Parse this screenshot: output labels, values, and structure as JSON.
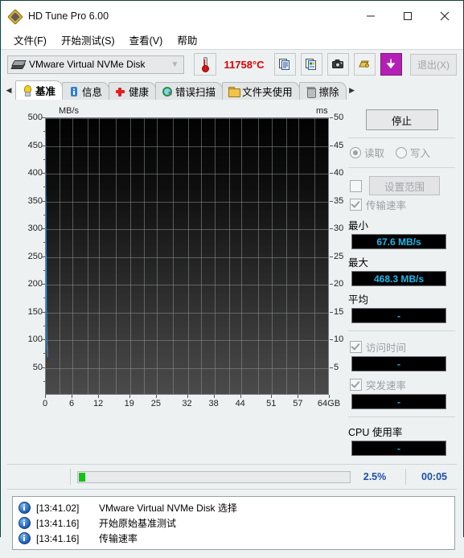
{
  "window": {
    "title": "HD Tune Pro 6.00",
    "app_icon": "hdtune-diamond-icon",
    "minimize": "minimize-icon",
    "maximize": "maximize-icon",
    "close": "close-icon"
  },
  "menu": [
    {
      "label": "文件(F)"
    },
    {
      "label": "开始测试(S)"
    },
    {
      "label": "查看(V)"
    },
    {
      "label": "帮助"
    }
  ],
  "toolbar": {
    "disk": "VMware Virtual NVMe Disk",
    "disk_icon": "hard-disk-icon",
    "dropdown_icon": "chevron-down-icon",
    "temperature": "11758°C",
    "temperature_color": "#e00000",
    "thermometer_icon": "thermometer-icon",
    "buttons": [
      {
        "name": "copy-text-icon"
      },
      {
        "name": "copy-image-icon"
      },
      {
        "name": "screenshot-icon"
      },
      {
        "name": "folder-yellow-icon"
      },
      {
        "name": "save-down-arrow-icon"
      }
    ],
    "exit_label": "退出(X)"
  },
  "tabs": {
    "scroll_left": "◁",
    "scroll_right": "▶",
    "items": [
      {
        "label": "基准",
        "icon": "lightbulb-icon",
        "active": true
      },
      {
        "label": "信息",
        "icon": "info-icon",
        "active": false
      },
      {
        "label": "健康",
        "icon": "red-cross-icon",
        "active": false
      },
      {
        "label": "错误扫描",
        "icon": "magnifier-icon",
        "active": false
      },
      {
        "label": "文件夹使用",
        "icon": "folder-icon",
        "active": false
      },
      {
        "label": "擦除",
        "icon": "trash-icon",
        "active": false
      }
    ]
  },
  "chart_data": {
    "type": "line",
    "title": "",
    "xlabel": "",
    "ylabel": "MB/s",
    "y2label": "ms",
    "xticks": [
      "0",
      "6",
      "12",
      "19",
      "25",
      "32",
      "38",
      "44",
      "51",
      "57",
      "64GB"
    ],
    "xvalues": [
      0,
      6,
      12,
      19,
      25,
      32,
      38,
      44,
      51,
      57,
      64
    ],
    "yticks": [
      500,
      450,
      400,
      350,
      300,
      250,
      200,
      150,
      100,
      50
    ],
    "ylim": [
      0,
      500
    ],
    "y2ticks": [
      50,
      45,
      40,
      35,
      30,
      25,
      20,
      15,
      10,
      5
    ],
    "y2lim": [
      0,
      50
    ],
    "grid": true,
    "legend": "none",
    "series": [
      {
        "name": "传输速率",
        "color": "#3a8fe0",
        "x": [
          0.05,
          0.1,
          0.14,
          0.18,
          0.22,
          0.26,
          0.3,
          0.34,
          0.38,
          0.42,
          0.46,
          0.5,
          0.54,
          0.58
        ],
        "y": [
          413,
          468,
          360,
          352,
          255,
          250,
          152,
          150,
          120,
          98,
          80,
          90,
          72,
          67.6
        ]
      }
    ]
  },
  "controls": {
    "stop_label": "停止",
    "read_label": "读取",
    "write_label": "写入",
    "read_selected": true,
    "range_label": "设置范围",
    "range_checked": false,
    "transfer_rate_label": "传输速率",
    "transfer_rate_checked": true,
    "min_label": "最小",
    "min_value": "67.6 MB/s",
    "max_label": "最大",
    "max_value": "468.3 MB/s",
    "avg_label": "平均",
    "avg_value": "-",
    "access_time_label": "访问时间",
    "access_time_checked": true,
    "access_time_value": "-",
    "burst_rate_label": "突发速率",
    "burst_rate_checked": true,
    "burst_rate_value": "-",
    "cpu_label": "CPU 使用率",
    "cpu_value": "-",
    "value_color": "#19b9ee"
  },
  "progress": {
    "percent_label": "2.5%",
    "percent": 2.5,
    "elapsed": "00:05",
    "fill_color": "#17c017",
    "text_color": "#1b4fa8"
  },
  "log": {
    "entries": [
      {
        "icon": "info-icon",
        "time": "[13:41.02]",
        "message": "VMware Virtual NVMe Disk 选择"
      },
      {
        "icon": "info-icon",
        "time": "[13:41.16]",
        "message": "开始原始基准测试"
      },
      {
        "icon": "info-icon",
        "time": "[13:41.16]",
        "message": "传输速率"
      }
    ]
  }
}
